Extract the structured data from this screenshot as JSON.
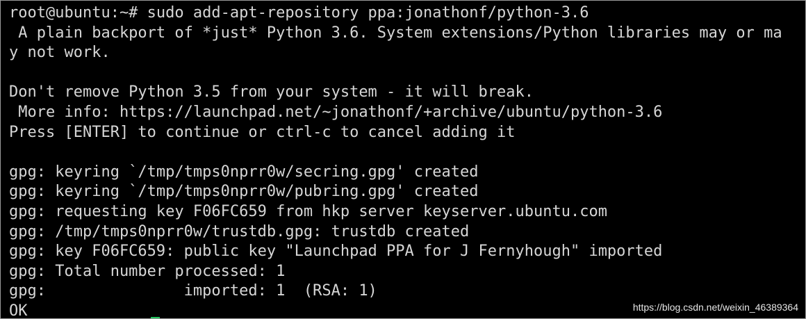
{
  "terminal": {
    "lines": [
      "root@ubuntu:~# sudo add-apt-repository ppa:jonathonf/python-3.6",
      " A plain backport of *just* Python 3.6. System extensions/Python libraries may or ma",
      "y not work.",
      "",
      "Don't remove Python 3.5 from your system - it will break.",
      " More info: https://launchpad.net/~jonathonf/+archive/ubuntu/python-3.6",
      "Press [ENTER] to continue or ctrl-c to cancel adding it",
      "",
      "gpg: keyring `/tmp/tmps0nprr0w/secring.gpg' created",
      "gpg: keyring `/tmp/tmps0nprr0w/pubring.gpg' created",
      "gpg: requesting key F06FC659 from hkp server keyserver.ubuntu.com",
      "gpg: /tmp/tmps0nprr0w/trustdb.gpg: trustdb created",
      "gpg: key F06FC659: public key \"Launchpad PPA for J Fernyhough\" imported",
      "gpg: Total number processed: 1",
      "gpg:               imported: 1  (RSA: 1)",
      "OK"
    ],
    "cursor_color": "#22c55e"
  },
  "watermark": {
    "text": "https://blog.csdn.net/weixin_46389364"
  }
}
